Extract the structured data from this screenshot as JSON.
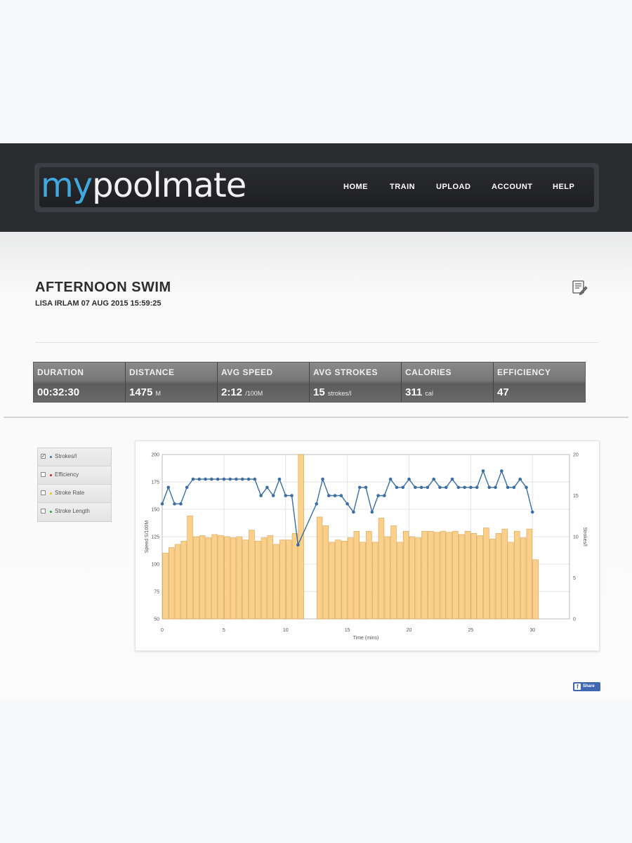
{
  "brand": {
    "logo_part1": "my",
    "logo_part2": "poolmate",
    "accent_color": "#3fa9e0"
  },
  "nav": {
    "items": [
      {
        "label": "HOME"
      },
      {
        "label": "TRAIN"
      },
      {
        "label": "UPLOAD"
      },
      {
        "label": "ACCOUNT"
      },
      {
        "label": "HELP"
      }
    ]
  },
  "swim": {
    "title": "AFTERNOON SWIM",
    "subtitle": "LISA IRLAM 07 AUG 2015 15:59:25",
    "edit_icon": "edit-icon"
  },
  "stats": [
    {
      "label": "DURATION",
      "value": "00:32:30",
      "unit": ""
    },
    {
      "label": "DISTANCE",
      "value": "1475",
      "unit": "M"
    },
    {
      "label": "AVG SPEED",
      "value": "2:12",
      "unit": "/100M"
    },
    {
      "label": "AVG STROKES",
      "value": "15",
      "unit": "strokes/l"
    },
    {
      "label": "CALORIES",
      "value": "311",
      "unit": "cal"
    },
    {
      "label": "EFFICIENCY",
      "value": "47",
      "unit": ""
    }
  ],
  "legend": [
    {
      "label": "Strokes/l",
      "checked": true,
      "color": "#3a6ea5"
    },
    {
      "label": "Efficiency",
      "checked": false,
      "color": "#cc2222"
    },
    {
      "label": "Stroke Rate",
      "checked": false,
      "color": "#e8c400"
    },
    {
      "label": "Stroke Length",
      "checked": false,
      "color": "#22aa22"
    }
  ],
  "chart_data": {
    "type": "bar",
    "xlabel": "Time (mins)",
    "ylabel": "Speed S/100M",
    "y2label": "Strokes/l",
    "xlim": [
      0,
      33
    ],
    "ylim": [
      50,
      200
    ],
    "y2lim": [
      0,
      20
    ],
    "xticks": [
      "0",
      "5",
      "10",
      "15",
      "20",
      "25",
      "30"
    ],
    "yticks": [
      "50",
      "75",
      "100",
      "125",
      "150",
      "175",
      "200"
    ],
    "y2ticks": [
      "0",
      "5",
      "10",
      "15",
      "20"
    ],
    "grid": true,
    "bar_color": "#fbd08a",
    "line_color": "#3a6ea5",
    "bars": {
      "x": [
        0.25,
        0.75,
        1.25,
        1.75,
        2.25,
        2.75,
        3.25,
        3.75,
        4.25,
        4.75,
        5.25,
        5.75,
        6.25,
        6.75,
        7.25,
        7.75,
        8.25,
        8.75,
        9.25,
        9.75,
        10.25,
        10.75,
        11.25,
        11.75,
        12.75,
        13.25,
        13.75,
        14.25,
        14.75,
        15.25,
        15.75,
        16.25,
        16.75,
        17.25,
        17.75,
        18.25,
        18.75,
        19.25,
        19.75,
        20.25,
        20.75,
        21.25,
        21.75,
        22.25,
        22.75,
        23.25,
        23.75,
        24.25,
        24.75,
        25.25,
        25.75,
        26.25,
        26.75,
        27.25,
        27.75,
        28.25,
        28.75,
        29.25,
        29.75,
        30.25,
        30.75,
        31.25
      ],
      "values": [
        110,
        115,
        118,
        121,
        144,
        125,
        126,
        124,
        127,
        126,
        125,
        124,
        125,
        122,
        131,
        121,
        124,
        126,
        118,
        122,
        122,
        128,
        200,
        0,
        143,
        135,
        120,
        122,
        121,
        124,
        130,
        120,
        130,
        120,
        142,
        125,
        135,
        120,
        130,
        125,
        124,
        130,
        130,
        129,
        130,
        129,
        130,
        127,
        130,
        128,
        126,
        133,
        123,
        128,
        132,
        120,
        130,
        124,
        132,
        104,
        0,
        0
      ]
    },
    "line": {
      "name": "Strokes/l",
      "x": [
        0,
        0.5,
        1,
        1.5,
        2,
        2.5,
        3,
        3.5,
        4,
        4.5,
        5,
        5.5,
        6,
        6.5,
        7,
        7.5,
        8,
        8.5,
        9,
        9.5,
        10,
        10.5,
        11,
        11.5,
        12.5,
        13,
        13.5,
        14,
        14.5,
        15,
        15.5,
        16,
        16.5,
        17,
        17.5,
        18,
        18.5,
        19,
        19.5,
        20,
        20.5,
        21,
        21.5,
        22,
        22.5,
        23,
        23.5,
        24,
        24.5,
        25,
        25.5,
        26,
        26.5,
        27,
        27.5,
        28,
        28.5,
        29,
        29.5,
        30,
        30.5,
        31,
        31.5
      ],
      "values": [
        14,
        16,
        14,
        14,
        16,
        17,
        17,
        17,
        17,
        17,
        17,
        17,
        17,
        17,
        17,
        17,
        15,
        16,
        15,
        17,
        15,
        15,
        9,
        0,
        14,
        17,
        15,
        15,
        15,
        14,
        13,
        16,
        16,
        13,
        15,
        15,
        17,
        16,
        16,
        17,
        16,
        16,
        16,
        17,
        16,
        16,
        17,
        16,
        16,
        16,
        16,
        18,
        16,
        16,
        18,
        16,
        16,
        17,
        16,
        13,
        0,
        0,
        0
      ]
    }
  },
  "share": {
    "label": "Share",
    "icon": "facebook-icon"
  }
}
